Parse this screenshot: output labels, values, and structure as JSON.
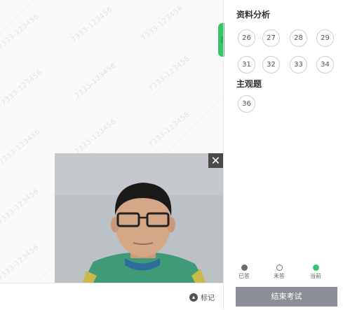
{
  "watermark": "7333-123456",
  "sections": [
    {
      "title": "资料分析",
      "questions": [
        "26",
        "27",
        "28",
        "29",
        "31",
        "32",
        "33",
        "34"
      ]
    },
    {
      "title": "主观题",
      "questions": [
        "36"
      ]
    }
  ],
  "legend": {
    "answered": "已答",
    "unanswered": "未答",
    "current": "当前",
    "answered_color": "#6b6f73",
    "current_color": "#39c36a"
  },
  "footer": {
    "mark_label": "标记",
    "end_exam_label": "结束考试"
  },
  "video": {
    "close_symbol": "✕"
  }
}
